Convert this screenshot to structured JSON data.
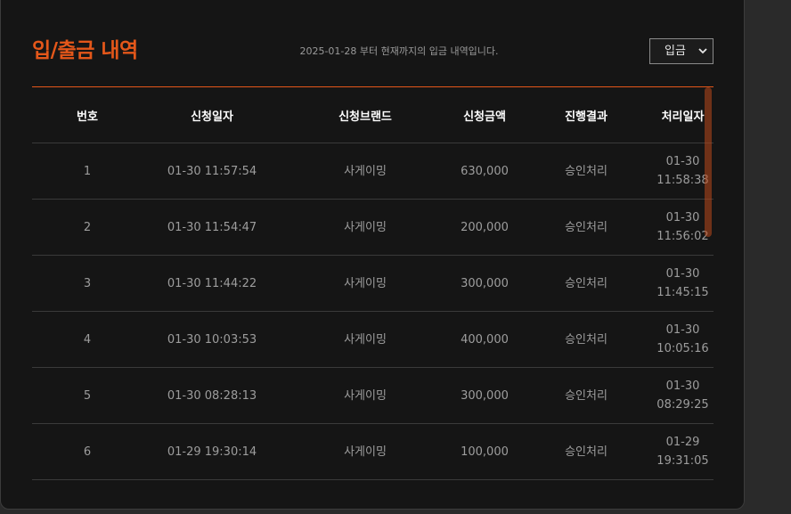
{
  "header": {
    "title": "입/출금 내역",
    "subtitle": "2025-01-28 부터 현재까지의 입금 내역입니다.",
    "filter_selected": "입금"
  },
  "table": {
    "columns": [
      "번호",
      "신청일자",
      "신청브랜드",
      "신청금액",
      "진행결과",
      "처리일자"
    ],
    "rows": [
      {
        "no": "1",
        "request_time": "01-30 11:57:54",
        "brand": "사게이밍",
        "amount": "630,000",
        "status": "승인처리",
        "processed_date": "01-30",
        "processed_time": "11:58:38"
      },
      {
        "no": "2",
        "request_time": "01-30 11:54:47",
        "brand": "사게이밍",
        "amount": "200,000",
        "status": "승인처리",
        "processed_date": "01-30",
        "processed_time": "11:56:02"
      },
      {
        "no": "3",
        "request_time": "01-30 11:44:22",
        "brand": "사게이밍",
        "amount": "300,000",
        "status": "승인처리",
        "processed_date": "01-30",
        "processed_time": "11:45:15"
      },
      {
        "no": "4",
        "request_time": "01-30 10:03:53",
        "brand": "사게이밍",
        "amount": "400,000",
        "status": "승인처리",
        "processed_date": "01-30",
        "processed_time": "10:05:16"
      },
      {
        "no": "5",
        "request_time": "01-30 08:28:13",
        "brand": "사게이밍",
        "amount": "300,000",
        "status": "승인처리",
        "processed_date": "01-30",
        "processed_time": "08:29:25"
      },
      {
        "no": "6",
        "request_time": "01-29 19:30:14",
        "brand": "사게이밍",
        "amount": "100,000",
        "status": "승인처리",
        "processed_date": "01-29",
        "processed_time": "19:31:05"
      }
    ]
  },
  "icons": {
    "select_chevron": "chevron-down-icon"
  },
  "colors": {
    "accent": "#e4571a",
    "background": "#151515",
    "text_muted": "#9d9d9d"
  }
}
